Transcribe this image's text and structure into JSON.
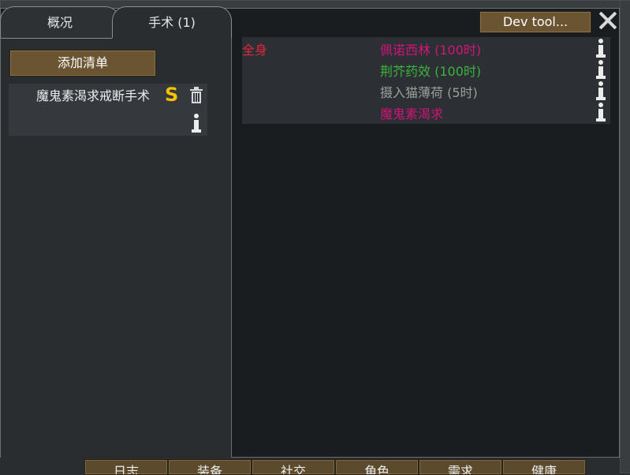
{
  "tabs": [
    {
      "label": "概况"
    },
    {
      "label": "手术 (1)"
    }
  ],
  "dev_button": "Dev tool...",
  "add_bill_button": "添加清单",
  "bill": {
    "label": "魔鬼素渴求戒断手术",
    "suspend_glyph": "S"
  },
  "health_rows": [
    {
      "part": "全身",
      "part_color": "#e0283a",
      "hediff": "佩诺西林 (100时)",
      "hediff_color": "#d2147a"
    },
    {
      "part": "",
      "part_color": "#e0283a",
      "hediff": "荆芥药效 (100时)",
      "hediff_color": "#3bb43b"
    },
    {
      "part": "",
      "part_color": "#e0283a",
      "hediff": "摄入猫薄荷 (5时)",
      "hediff_color": "#9aa09a"
    },
    {
      "part": "",
      "part_color": "#e0283a",
      "hediff": "魔鬼素渴求",
      "hediff_color": "#d2147a"
    }
  ],
  "bottom_tabs": [
    {
      "label": "日志"
    },
    {
      "label": "装备"
    },
    {
      "label": "社交"
    },
    {
      "label": "角色"
    },
    {
      "label": "需求"
    },
    {
      "label": "健康"
    }
  ],
  "colors": {
    "window_bg": "#1a1d20",
    "panel_bg": "#2a2d30",
    "button_bg": "#6a5431",
    "suspend_icon": "#f2c200"
  },
  "icons": [
    "close-icon",
    "trash-icon",
    "info-icon",
    "suspend-icon"
  ]
}
